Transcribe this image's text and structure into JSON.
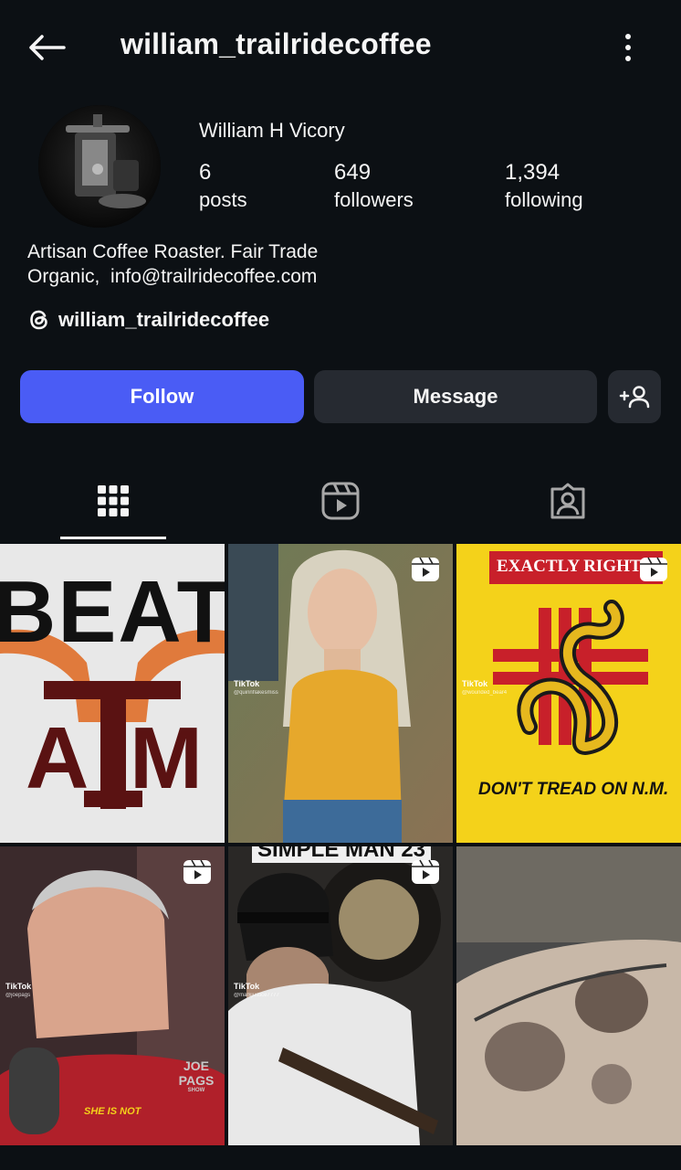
{
  "header": {
    "username": "william_trailridecoffee",
    "back_icon": "arrow-left-icon",
    "more_icon": "more-vertical-icon"
  },
  "profile": {
    "full_name": "William H Vicory",
    "stats": {
      "posts": {
        "value": "6",
        "label": "posts"
      },
      "followers": {
        "value": "649",
        "label": "followers"
      },
      "following": {
        "value": "1,394",
        "label": "following"
      }
    },
    "bio_line1": "Artisan Coffee Roaster. Fair Trade",
    "bio_line2": "Organic,  info@trailridecoffee.com",
    "threads_handle": "william_trailridecoffee"
  },
  "actions": {
    "follow_label": "Follow",
    "message_label": "Message",
    "add_icon": "add-person-icon"
  },
  "tabs": [
    "grid-icon",
    "reels-icon",
    "tagged-icon"
  ],
  "posts": [
    {
      "type": "image",
      "text1": "BEAT",
      "text2": "A",
      "text3": "M"
    },
    {
      "type": "reel",
      "tiktok": "TikTok",
      "handle": "@quinnflakesmiss"
    },
    {
      "type": "reel",
      "tiktok": "TikTok",
      "handle": "@wounded_bear4",
      "banner": "EXACTLY RIGHT",
      "caption": "DON'T TREAD ON N.M."
    },
    {
      "type": "reel",
      "tiktok": "TikTok",
      "handle": "@joepags",
      "logo": "JOE PAGS",
      "logo_sub": "SHOW",
      "caption": "SHE IS NOT"
    },
    {
      "type": "reel",
      "tiktok": "TikTok",
      "handle": "@markjustice7777",
      "top_text": "SIMPLE MAN 23"
    },
    {
      "type": "image"
    }
  ],
  "colors": {
    "background": "#0c1014",
    "follow_button": "#4a5cf5",
    "secondary_button": "#262a31"
  }
}
